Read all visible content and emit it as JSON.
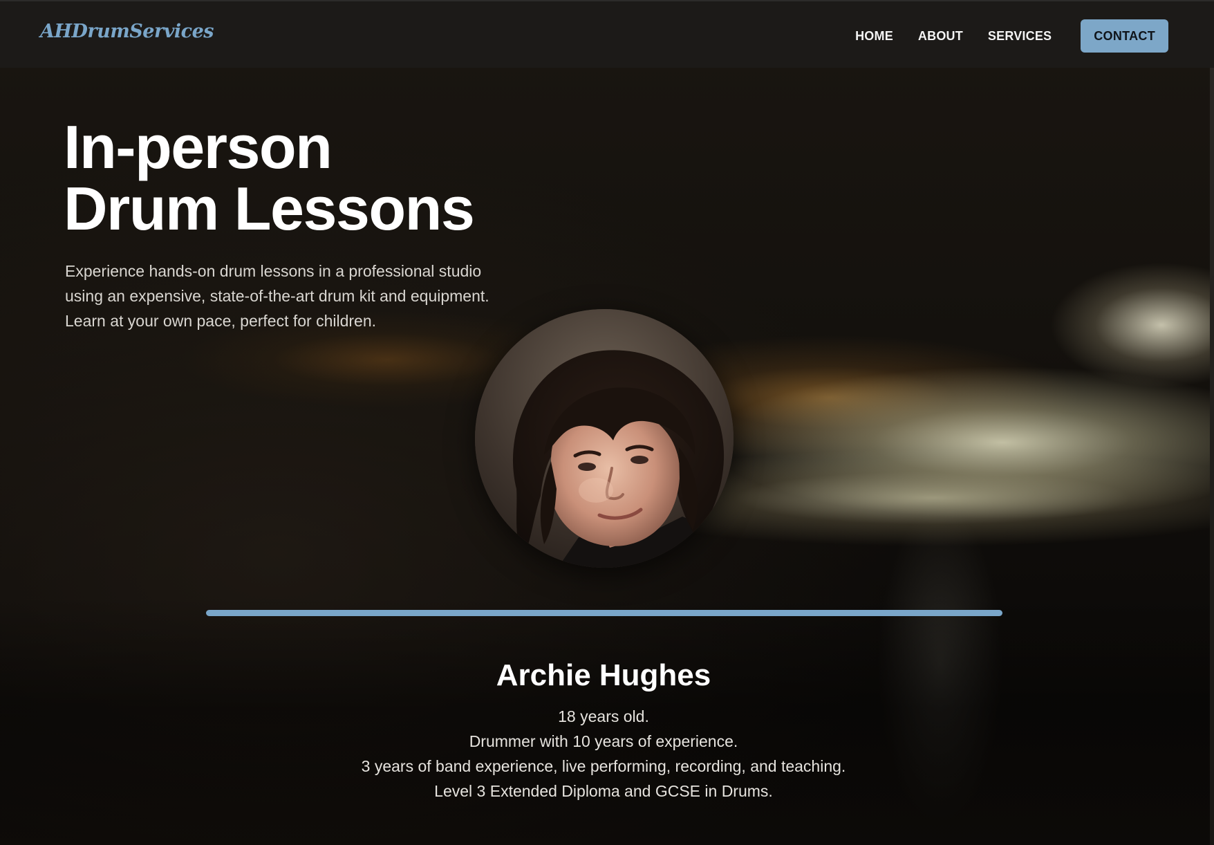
{
  "nav": {
    "logo": "AHDrumServices",
    "links": [
      "HOME",
      "ABOUT",
      "SERVICES"
    ],
    "contact": "CONTACT"
  },
  "hero": {
    "title_line1": "In-person",
    "title_line2": "Drum Lessons",
    "description": "Experience hands-on drum lessons in a professional studio using an expensive, state-of-the-art drum kit and equipment. Learn at your own pace, perfect for children."
  },
  "bio": {
    "name": "Archie Hughes",
    "lines": [
      "18 years old.",
      "Drummer with 10 years of experience.",
      "3 years of band experience, live performing, recording, and teaching.",
      "Level 3 Extended Diploma and GCSE in Drums."
    ]
  },
  "colors": {
    "accent": "#7aa6c9",
    "nav_bg": "#1c1a18",
    "text": "#ffffff"
  },
  "icons": {
    "avatar": "portrait-photo"
  }
}
